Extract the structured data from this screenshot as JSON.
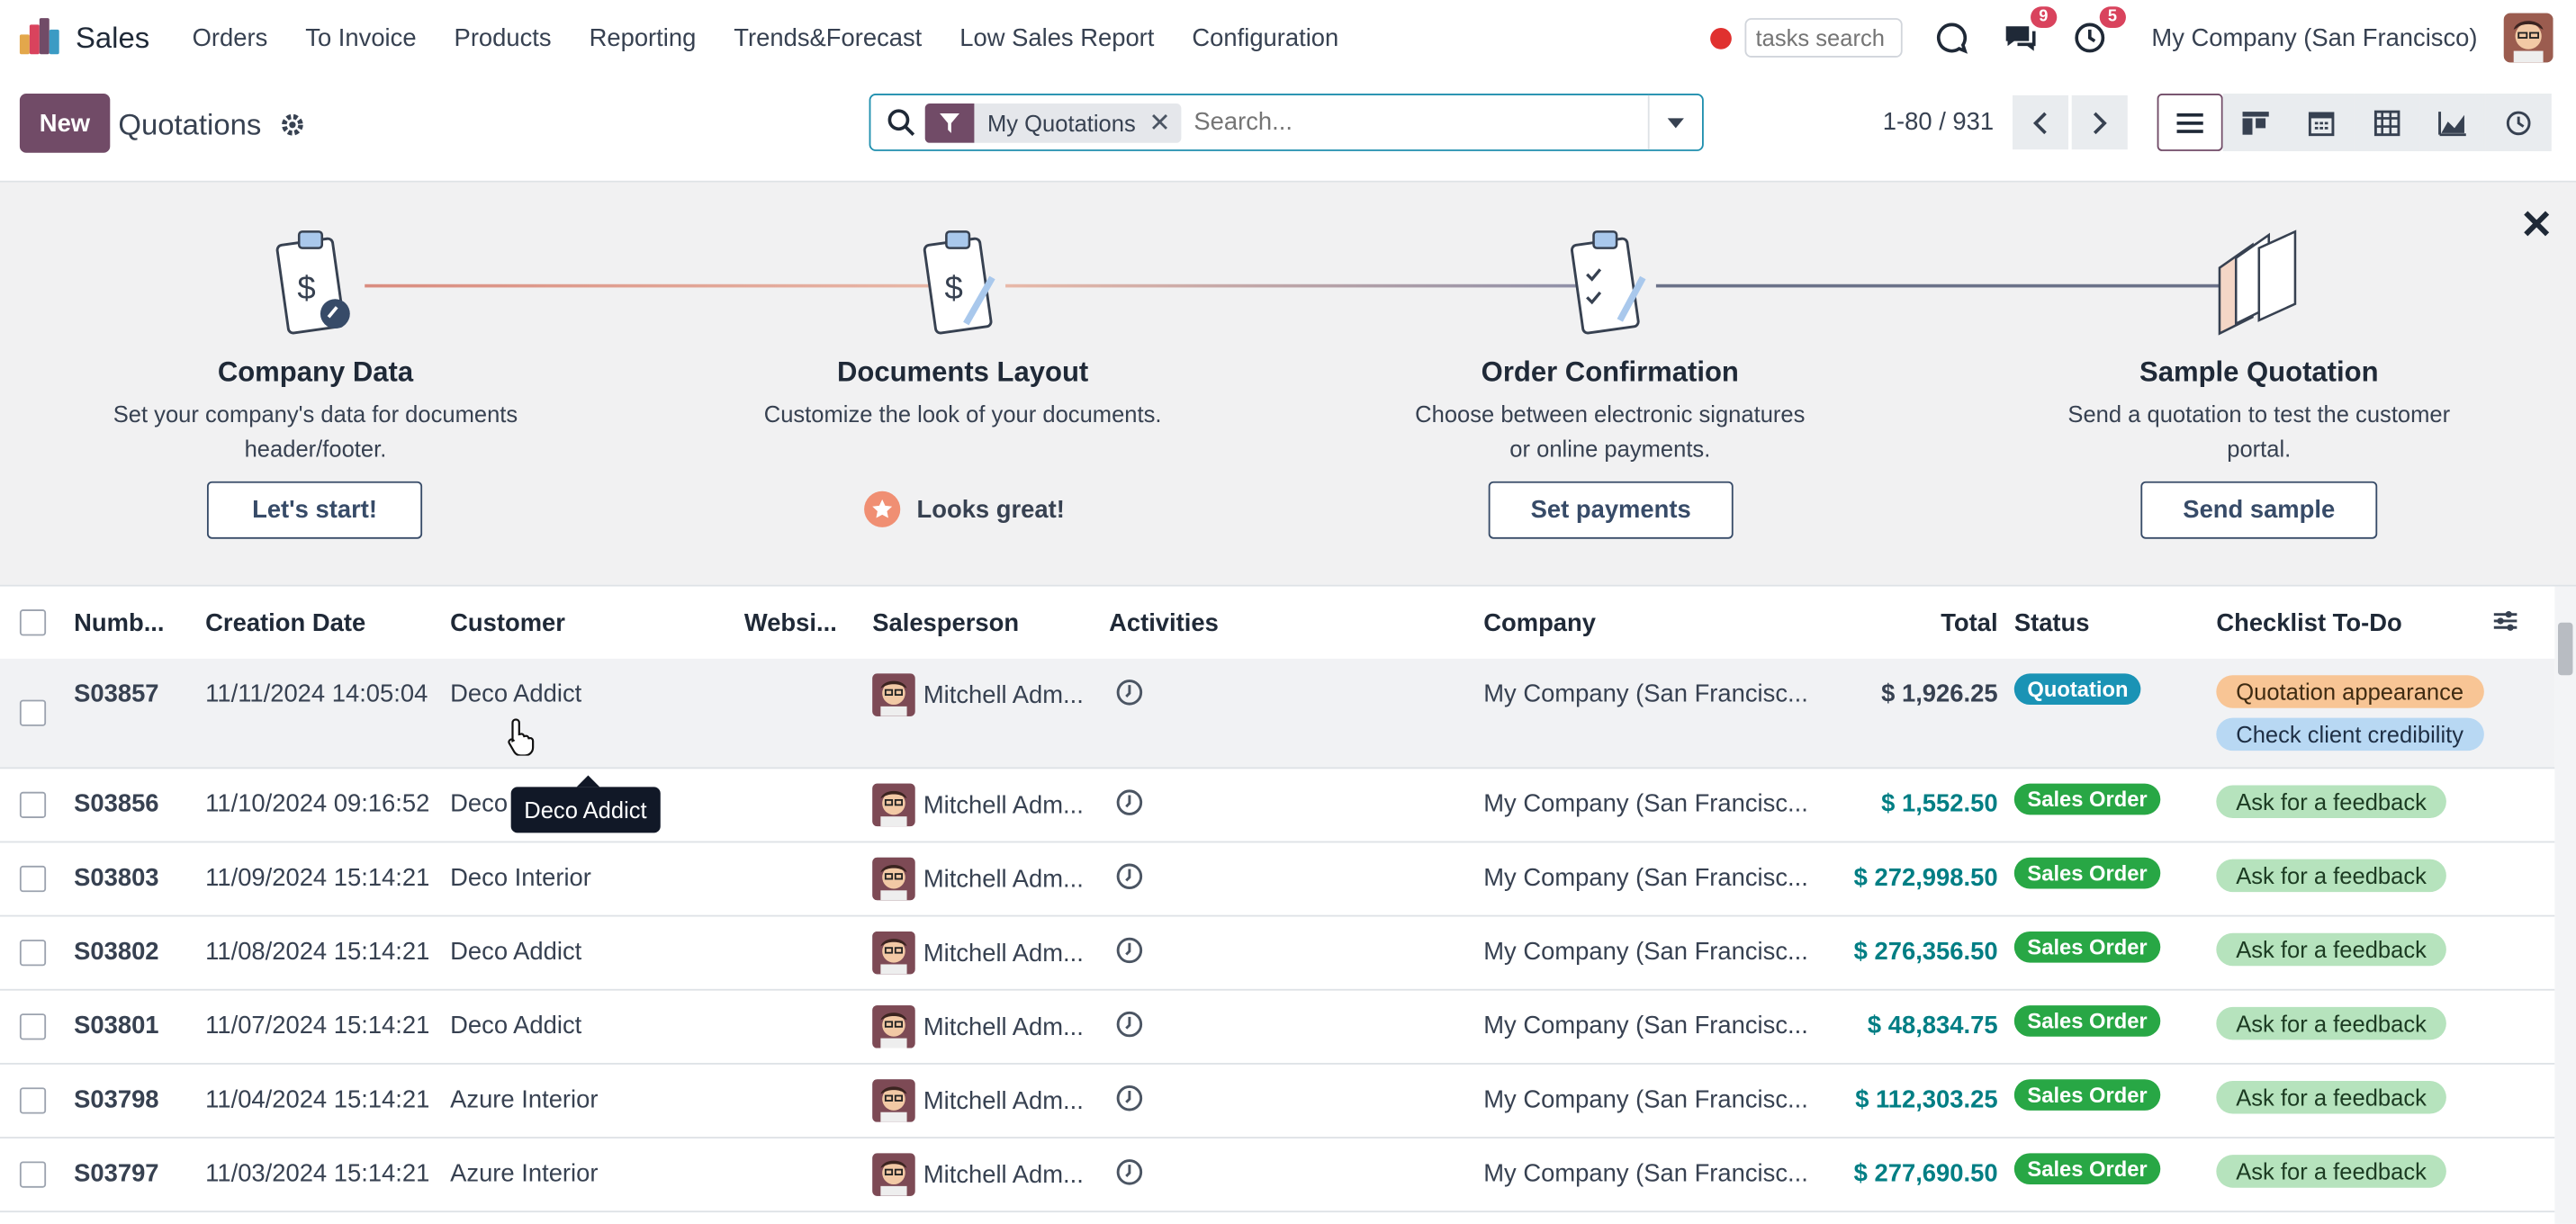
{
  "app": {
    "name": "Sales",
    "menu": [
      "Orders",
      "To Invoice",
      "Products",
      "Reporting",
      "Trends&Forecast",
      "Low Sales Report",
      "Configuration"
    ]
  },
  "systray": {
    "tasks_search_placeholder": "tasks search",
    "messages_count": "9",
    "activities_count": "5",
    "company": "My Company (San Francisco)"
  },
  "control_panel": {
    "new_label": "New",
    "title": "Quotations",
    "facet_label": "My Quotations",
    "search_placeholder": "Search...",
    "pager": "1-80 / 931"
  },
  "onboarding": {
    "steps": [
      {
        "title": "Company Data",
        "description": "Set your company's data for documents header/footer.",
        "button": "Let's start!"
      },
      {
        "title": "Documents Layout",
        "description": "Customize the look of your documents.",
        "done_label": "Looks great!"
      },
      {
        "title": "Order Confirmation",
        "description": "Choose between electronic signatures or online payments.",
        "button": "Set payments"
      },
      {
        "title": "Sample Quotation",
        "description": "Send a quotation to test the customer portal.",
        "button": "Send sample"
      }
    ]
  },
  "table": {
    "headers": {
      "number": "Numb...",
      "date": "Creation Date",
      "customer": "Customer",
      "website": "Websi...",
      "salesperson": "Salesperson",
      "activities": "Activities",
      "company": "Company",
      "total": "Total",
      "status": "Status",
      "checklist": "Checklist To-Do"
    },
    "rows": [
      {
        "number": "S03857",
        "date": "11/11/2024 14:05:04",
        "customer": "Deco Addict",
        "salesperson": "Mitchell Adm...",
        "company": "My Company (San Francisc...",
        "total": "$ 1,926.25",
        "status": "Quotation",
        "tags": [
          "Quotation appearance",
          "Check client credibility"
        ]
      },
      {
        "number": "S03856",
        "date": "11/10/2024 09:16:52",
        "customer": "Deco",
        "salesperson": "Mitchell Adm...",
        "company": "My Company (San Francisc...",
        "total": "$ 1,552.50",
        "status": "Sales Order",
        "tags": [
          "Ask for a feedback"
        ]
      },
      {
        "number": "S03803",
        "date": "11/09/2024 15:14:21",
        "customer": "Deco Interior",
        "salesperson": "Mitchell Adm...",
        "company": "My Company (San Francisc...",
        "total": "$ 272,998.50",
        "status": "Sales Order",
        "tags": [
          "Ask for a feedback"
        ]
      },
      {
        "number": "S03802",
        "date": "11/08/2024 15:14:21",
        "customer": "Deco Addict",
        "salesperson": "Mitchell Adm...",
        "company": "My Company (San Francisc...",
        "total": "$ 276,356.50",
        "status": "Sales Order",
        "tags": [
          "Ask for a feedback"
        ]
      },
      {
        "number": "S03801",
        "date": "11/07/2024 15:14:21",
        "customer": "Deco Addict",
        "salesperson": "Mitchell Adm...",
        "company": "My Company (San Francisc...",
        "total": "$ 48,834.75",
        "status": "Sales Order",
        "tags": [
          "Ask for a feedback"
        ]
      },
      {
        "number": "S03798",
        "date": "11/04/2024 15:14:21",
        "customer": "Azure Interior",
        "salesperson": "Mitchell Adm...",
        "company": "My Company (San Francisc...",
        "total": "$ 112,303.25",
        "status": "Sales Order",
        "tags": [
          "Ask for a feedback"
        ]
      },
      {
        "number": "S03797",
        "date": "11/03/2024 15:14:21",
        "customer": "Azure Interior",
        "salesperson": "Mitchell Adm...",
        "company": "My Company (San Francisc...",
        "total": "$ 277,690.50",
        "status": "Sales Order",
        "tags": [
          "Ask for a feedback"
        ]
      }
    ]
  },
  "tooltip": "Deco Addict",
  "colors": {
    "brand": "#714b67",
    "accent": "#017e84",
    "quotation": "#1a93b5",
    "sales_order": "#28a745"
  }
}
